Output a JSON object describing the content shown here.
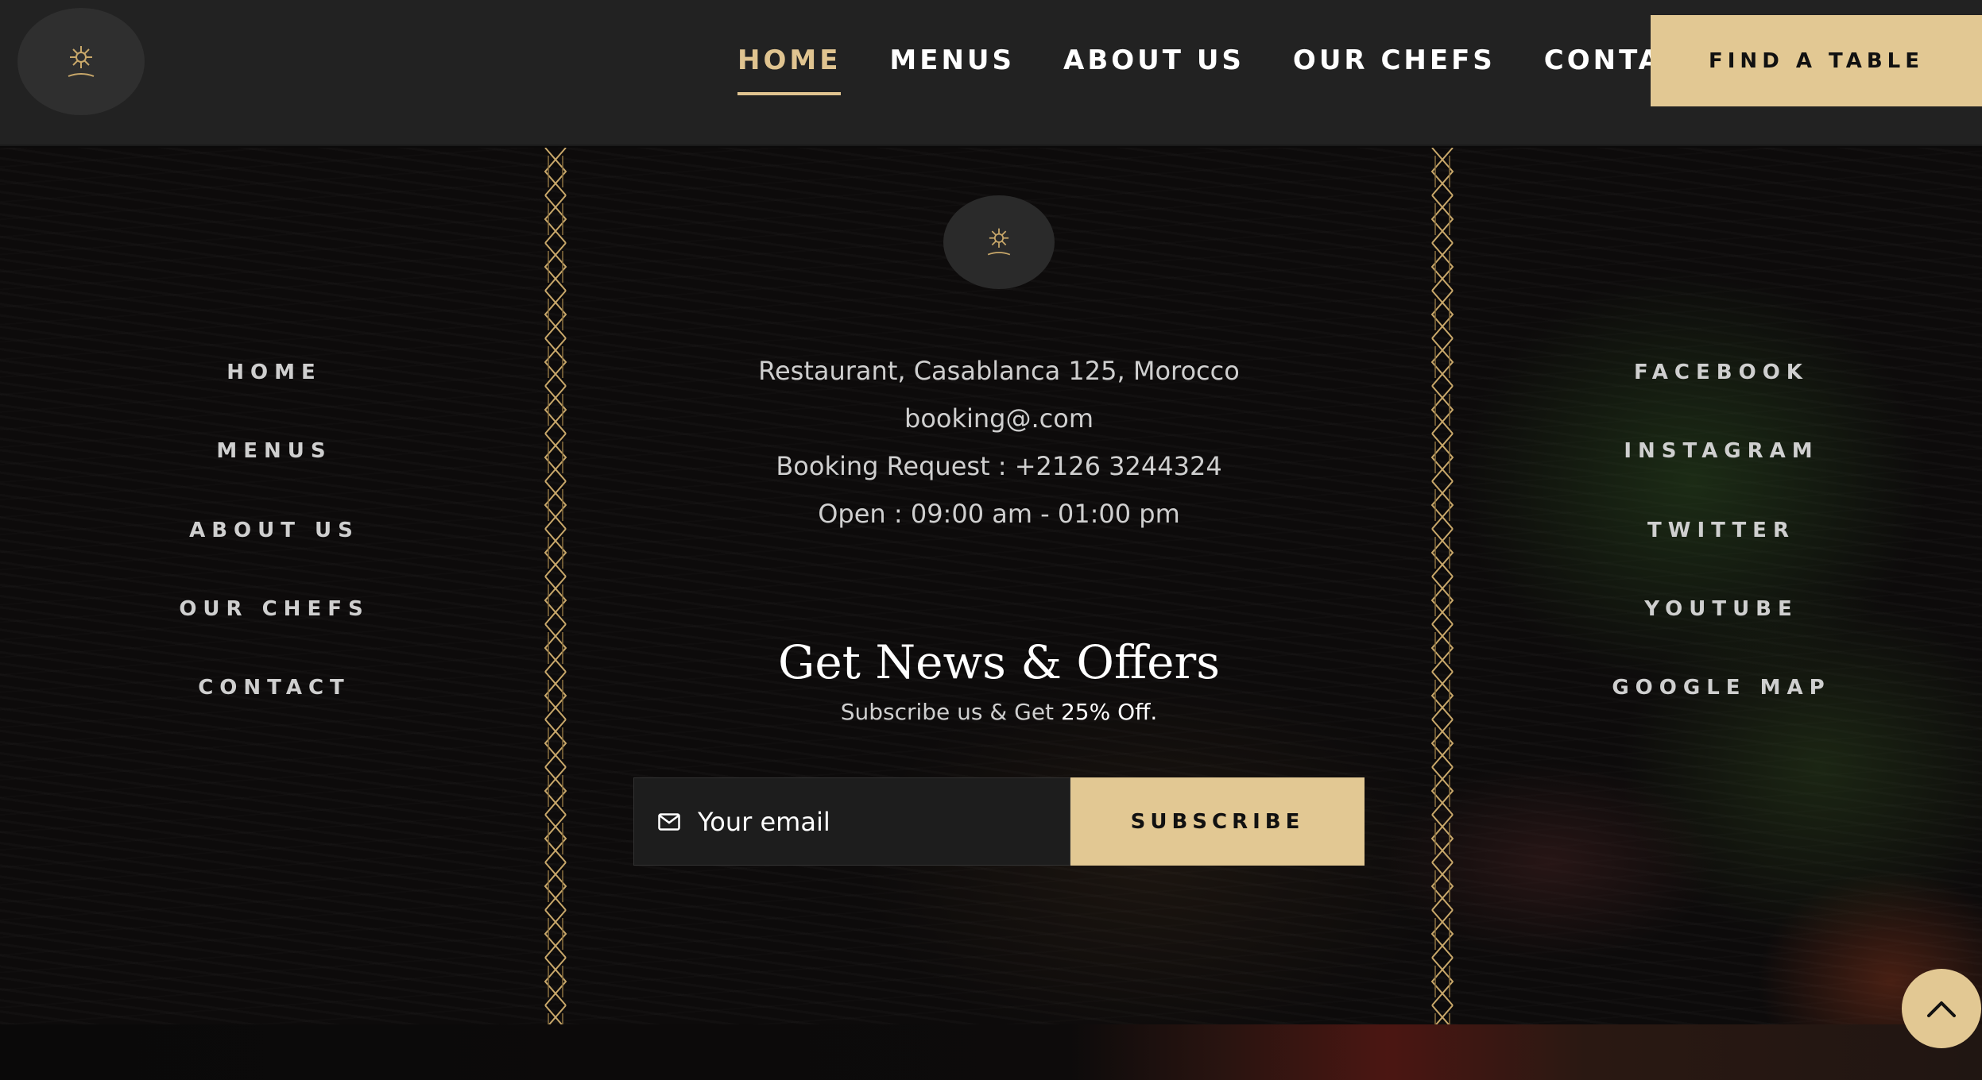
{
  "header": {
    "logo_icon": "restaurant-emblem-icon",
    "nav": [
      {
        "label": "HOME",
        "active": true
      },
      {
        "label": "MENUS",
        "active": false
      },
      {
        "label": "ABOUT US",
        "active": false
      },
      {
        "label": "OUR CHEFS",
        "active": false
      },
      {
        "label": "CONTACT",
        "active": false
      }
    ],
    "cta_label": "FIND A TABLE"
  },
  "footer": {
    "left_links": [
      "HOME",
      "MENUS",
      "ABOUT US",
      "OUR CHEFS",
      "CONTACT"
    ],
    "right_links": [
      "FACEBOOK",
      "INSTAGRAM",
      "TWITTER",
      "YOUTUBE",
      "GOOGLE MAP"
    ],
    "info": {
      "address": "Restaurant, Casablanca 125, Morocco",
      "email": "booking@.com",
      "booking": "Booking Request : +2126 3244324",
      "hours": "Open : 09:00 am - 01:00 pm"
    },
    "newsletter": {
      "title": "Get News & Offers",
      "subtitle_prefix": "Subscribe us & Get",
      "subtitle_highlight": "25% Off.",
      "email_placeholder": "Your email",
      "button_label": "SUBSCRIBE"
    }
  },
  "colors": {
    "accent": "#e2c893",
    "header_bg": "#222222",
    "page_bg": "#0d0b0b"
  },
  "icons": {
    "mail": "mail-icon",
    "back_to_top": "chevron-up-icon"
  }
}
